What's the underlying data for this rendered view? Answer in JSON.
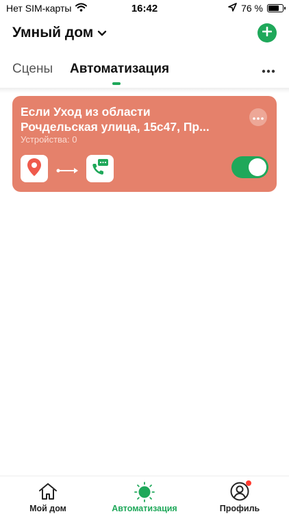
{
  "status_bar": {
    "carrier": "Нет SIM-карты",
    "time": "16:42",
    "battery_percent": "76 %",
    "battery_level": 0.76,
    "icons": [
      "wifi-icon",
      "location-arrow-icon",
      "battery-icon"
    ]
  },
  "header": {
    "title": "Умный дом",
    "icons": [
      "chevron-down-icon",
      "plus-icon"
    ]
  },
  "tabs": {
    "items": [
      {
        "label": "Сцены",
        "active": false
      },
      {
        "label": "Автоматизация",
        "active": true
      }
    ],
    "more_icon": "more-dots-icon"
  },
  "automation_card": {
    "line1": "Если Уход из области",
    "line2": "Рочдельская улица, 15с47, Пр...",
    "devices": "Устройства: 0",
    "trigger_icon": "location-pin-icon",
    "arrow_icon": "arrow-right-icon",
    "action_icon": "phone-message-icon",
    "enabled": true,
    "background_color": "#e5816b"
  },
  "bottom_nav": {
    "items": [
      {
        "label": "Мой дом",
        "icon": "home-icon",
        "active": false
      },
      {
        "label": "Автоматизация",
        "icon": "sun-icon",
        "active": true
      },
      {
        "label": "Профиль",
        "icon": "profile-icon",
        "active": false,
        "badge": true
      }
    ]
  },
  "colors": {
    "accent": "#1fa85a",
    "card": "#e5816b",
    "badge": "#ff3b30"
  }
}
